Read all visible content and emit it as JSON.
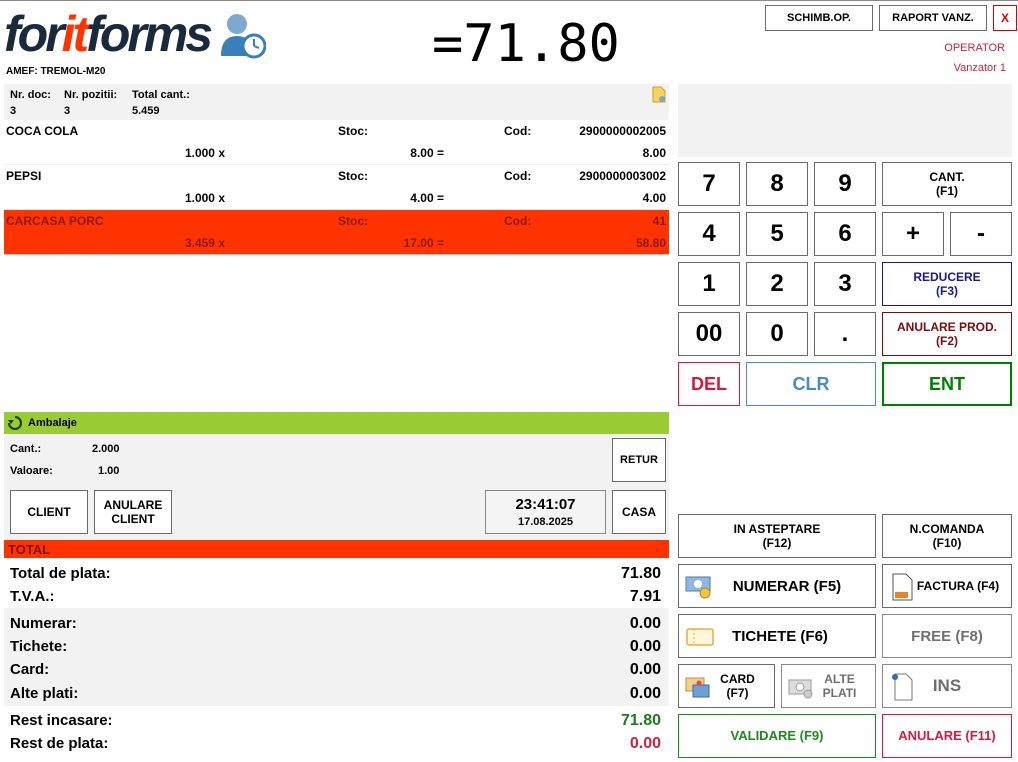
{
  "logo": {
    "part1": "for",
    "part2": "it",
    "part3": "forms"
  },
  "amef": "AMEF: TREMOL-M20",
  "display_total": "=71.80",
  "top_buttons": {
    "schimb": "SCHIMB.OP.",
    "raport": "RAPORT VANZ.",
    "close": "X"
  },
  "operator": {
    "label": "OPERATOR",
    "name": "Vanzator 1"
  },
  "doc_header": {
    "nr_doc_label": "Nr. doc:",
    "nr_doc": "3",
    "nr_poz_label": "Nr. pozitii:",
    "nr_poz": "3",
    "total_cant_label": "Total cant.:",
    "total_cant": "5.459"
  },
  "items": [
    {
      "name": "COCA COLA",
      "stoc_label": "Stoc:",
      "cod_label": "Cod:",
      "cod": "2900000002005",
      "qty": "1.000 x",
      "price": "8.00 =",
      "total": "8.00"
    },
    {
      "name": "PEPSI",
      "stoc_label": "Stoc:",
      "cod_label": "Cod:",
      "cod": "2900000003002",
      "qty": "1.000 x",
      "price": "4.00 =",
      "total": "4.00"
    },
    {
      "name": "CARCASA PORC",
      "stoc_label": "Stoc:",
      "cod_label": "Cod:",
      "cod": "41",
      "qty": "3.459 x",
      "price": "17.00 =",
      "total": "58.80"
    }
  ],
  "ambalaje": {
    "title": "Ambalaje",
    "cant_label": "Cant.:",
    "cant": "2.000",
    "valoare_label": "Valoare:",
    "valoare": "1.00",
    "retur": "RETUR"
  },
  "client_buttons": {
    "client": "CLIENT",
    "anulare_client_1": "ANULARE",
    "anulare_client_2": "CLIENT",
    "casa": "CASA"
  },
  "clock": {
    "time": "23:41:07",
    "date": "17.08.2025"
  },
  "totals": {
    "title": "TOTAL",
    "total_label": "Total de plata:",
    "total": "71.80",
    "tva_label": "T.V.A.:",
    "tva": "7.91",
    "numerar_label": "Numerar:",
    "numerar": "0.00",
    "tichete_label": "Tichete:",
    "tichete": "0.00",
    "card_label": "Card:",
    "card": "0.00",
    "alte_label": "Alte plati:",
    "alte": "0.00",
    "rest_inc_label": "Rest incasare:",
    "rest_inc": "71.80",
    "rest_plata_label": "Rest de plata:",
    "rest_plata": "0.00"
  },
  "keypad": {
    "k7": "7",
    "k8": "8",
    "k9": "9",
    "cant_1": "CANT.",
    "cant_2": "(F1)",
    "k4": "4",
    "k5": "5",
    "k6": "6",
    "plus": "+",
    "minus": "-",
    "k1": "1",
    "k2": "2",
    "k3": "3",
    "reducere_1": "REDUCERE",
    "reducere_2": "(F3)",
    "k00": "00",
    "k0": "0",
    "dot": ".",
    "anulare_prod_1": "ANULARE PROD.",
    "anulare_prod_2": "(F2)",
    "del": "DEL",
    "clr": "CLR",
    "ent": "ENT"
  },
  "payment": {
    "asteptare_1": "IN ASTEPTARE",
    "asteptare_2": "(F12)",
    "ncomanda_1": "N.COMANDA",
    "ncomanda_2": "(F10)",
    "numerar": "NUMERAR (F5)",
    "factura": "FACTURA (F4)",
    "tichete": "TICHETE (F6)",
    "free": "FREE (F8)",
    "card_1": "CARD",
    "card_2": "(F7)",
    "alte_1": "ALTE",
    "alte_2": "PLATI",
    "ins": "INS",
    "validare": "VALIDARE (F9)",
    "anulare": "ANULARE (F11)"
  },
  "colors": {
    "accent_red": "#ff3300",
    "green_bar": "#99cc33",
    "del_red": "#d81b3c",
    "clr_blue": "#4a8bc0",
    "ent_green": "#008000"
  }
}
